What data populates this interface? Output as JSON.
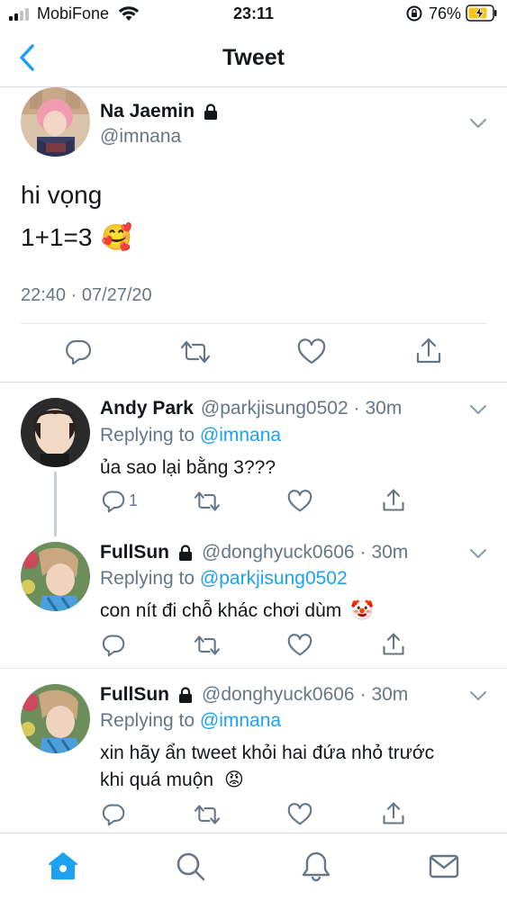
{
  "status_bar": {
    "carrier": "MobiFone",
    "time": "23:11",
    "battery_percent": "76%"
  },
  "nav": {
    "title": "Tweet",
    "back_icon": "chevron-left-icon"
  },
  "main_tweet": {
    "name": "Na Jaemin",
    "handle": "@imnana",
    "text_line1": "hi vọng",
    "text_line2": "1+1=3",
    "emoji": "🥰",
    "timestamp": "22:40 · 07/27/20"
  },
  "replies": [
    {
      "name": "Andy Park",
      "handle": "@parkjisung0502",
      "age": "· 30m",
      "replying_prefix": "Replying to ",
      "replying_to": "@imnana",
      "text": "ủa sao lại bằng 3???",
      "reply_count": "1",
      "locked": false
    },
    {
      "name": "FullSun",
      "handle": "@donghyuck0606",
      "age": "· 30m",
      "replying_prefix": "Replying to ",
      "replying_to": "@parkjisung0502",
      "text": "con nít đi chỗ khác chơi dùm",
      "emoji": "🤡",
      "locked": true
    },
    {
      "name": "FullSun",
      "handle": "@donghyuck0606",
      "age": "· 30m",
      "replying_prefix": "Replying to ",
      "replying_to": "@imnana",
      "text_line1": "xin hãy ẩn tweet khỏi hai đứa nhỏ trước",
      "text_line2": "khi quá muộn",
      "emoji": "😡",
      "locked": true
    }
  ],
  "tabbar": {
    "tabs": [
      "home-icon",
      "search-icon",
      "bell-icon",
      "mail-icon"
    ],
    "active_color": "#1da1f2"
  },
  "colors": {
    "accent": "#1da1f2",
    "muted": "#657786",
    "text": "#14171a"
  }
}
